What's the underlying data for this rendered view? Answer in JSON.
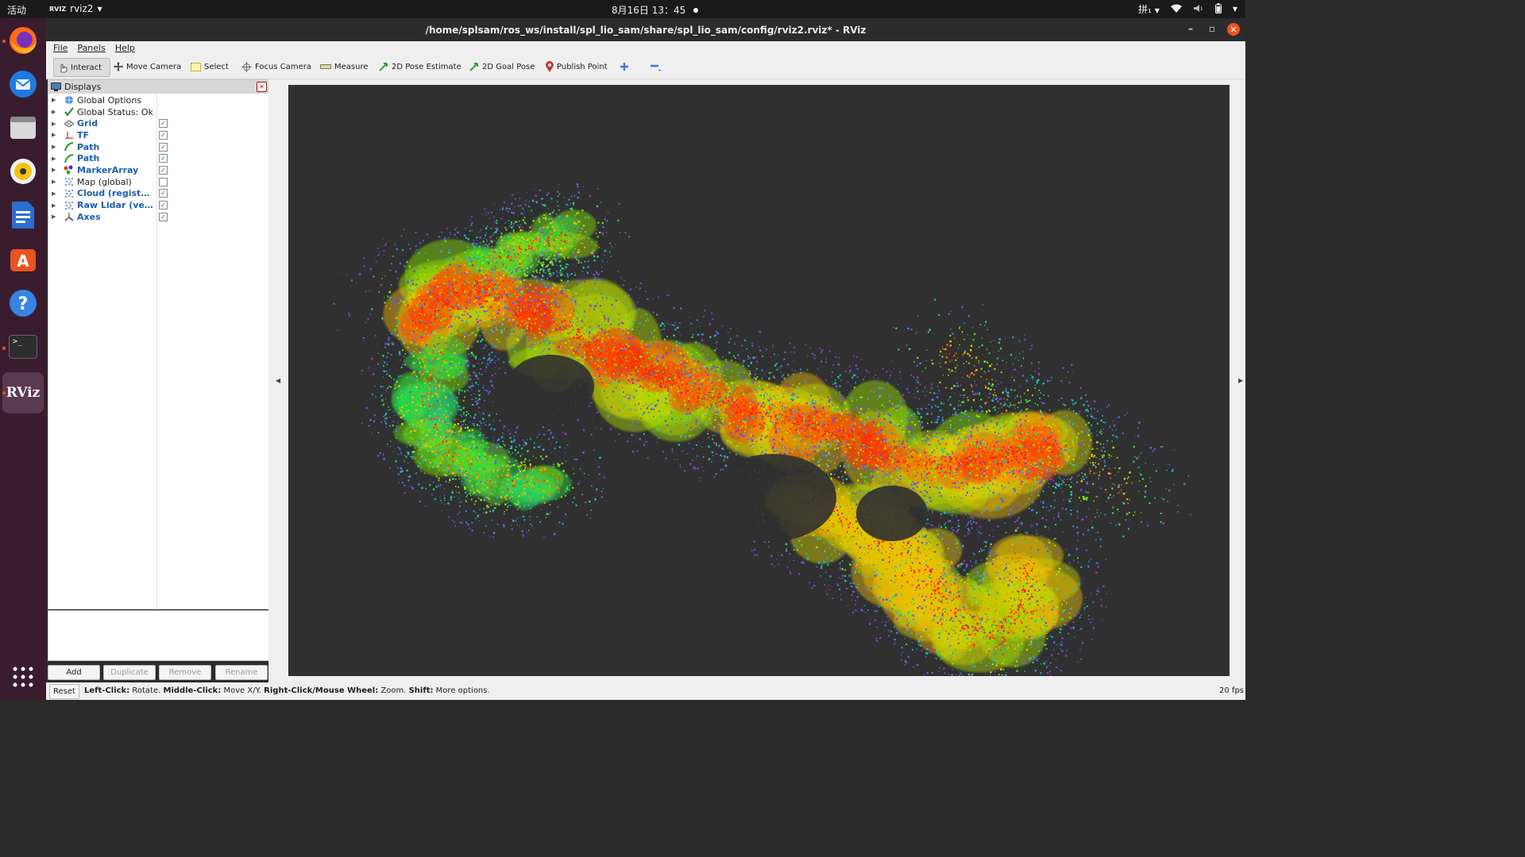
{
  "topbar": {
    "activities": "活动",
    "app_name": "rviz2",
    "app_logo": "RVIZ",
    "clock": "8月16日  13：45",
    "input_method": "拼₁",
    "icons": [
      "network-icon",
      "volume-icon",
      "battery-icon",
      "system-menu-icon"
    ]
  },
  "dock": {
    "items": [
      "firefox-icon",
      "thunderbird-icon",
      "files-icon",
      "rhythmbox-icon",
      "writer-icon",
      "app-center-icon",
      "help-icon",
      "terminal-icon",
      "rviz-icon",
      "show-apps-icon"
    ],
    "rviz_label": "RViz",
    "terminal_label": ">_"
  },
  "window": {
    "title": "/home/splsam/ros_ws/install/spl_lio_sam/share/spl_lio_sam/config/rviz2.rviz* - RViz"
  },
  "menu": {
    "file": "File",
    "panels": "Panels",
    "help": "Help"
  },
  "toolbar": {
    "interact": "Interact",
    "move_camera": "Move Camera",
    "select": "Select",
    "focus_camera": "Focus Camera",
    "measure": "Measure",
    "pose_estimate": "2D Pose Estimate",
    "goal_pose": "2D Goal Pose",
    "publish_point": "Publish Point"
  },
  "displays": {
    "title": "Displays",
    "items": [
      {
        "label": "Global Options",
        "icon": "globe-icon",
        "checkbox": false,
        "checked": false,
        "blue": false
      },
      {
        "label": "Global Status: Ok",
        "icon": "check-icon",
        "checkbox": false,
        "checked": false,
        "blue": false
      },
      {
        "label": "Grid",
        "icon": "grid-icon",
        "checkbox": true,
        "checked": true,
        "blue": true
      },
      {
        "label": "TF",
        "icon": "tf-icon",
        "checkbox": true,
        "checked": true,
        "blue": true
      },
      {
        "label": "Path",
        "icon": "path-icon",
        "checkbox": true,
        "checked": true,
        "blue": true
      },
      {
        "label": "Path",
        "icon": "path-icon",
        "checkbox": true,
        "checked": true,
        "blue": true
      },
      {
        "label": "MarkerArray",
        "icon": "marker-array-icon",
        "checkbox": true,
        "checked": true,
        "blue": true
      },
      {
        "label": "Map (global)",
        "icon": "pointcloud-icon",
        "checkbox": true,
        "checked": false,
        "blue": false
      },
      {
        "label": "Cloud (register...",
        "icon": "pointcloud-icon",
        "checkbox": true,
        "checked": true,
        "blue": true
      },
      {
        "label": "Raw Lidar (velo...",
        "icon": "pointcloud-icon",
        "checkbox": true,
        "checked": true,
        "blue": true
      },
      {
        "label": "Axes",
        "icon": "axes-icon",
        "checkbox": true,
        "checked": true,
        "blue": true
      }
    ]
  },
  "panel_buttons": {
    "add": "Add",
    "duplicate": "Duplicate",
    "remove": "Remove",
    "rename": "Rename"
  },
  "status": {
    "reset": "Reset",
    "hint_parts": [
      {
        "text": "Left-Click:",
        "bold": true
      },
      {
        "text": " Rotate. ",
        "bold": false
      },
      {
        "text": "Middle-Click:",
        "bold": true
      },
      {
        "text": " Move X/Y. ",
        "bold": false
      },
      {
        "text": "Right-Click/Mouse Wheel:",
        "bold": true
      },
      {
        "text": " Zoom. ",
        "bold": false
      },
      {
        "text": "Shift:",
        "bold": true
      },
      {
        "text": " More options.",
        "bold": false
      }
    ],
    "fps": "20 fps"
  },
  "colors": {
    "ubuntu_orange": "#e95420",
    "viewport_bg": "#303030",
    "dock_bg": "#3a1c2f",
    "item_blue": "#1a5fb4"
  }
}
